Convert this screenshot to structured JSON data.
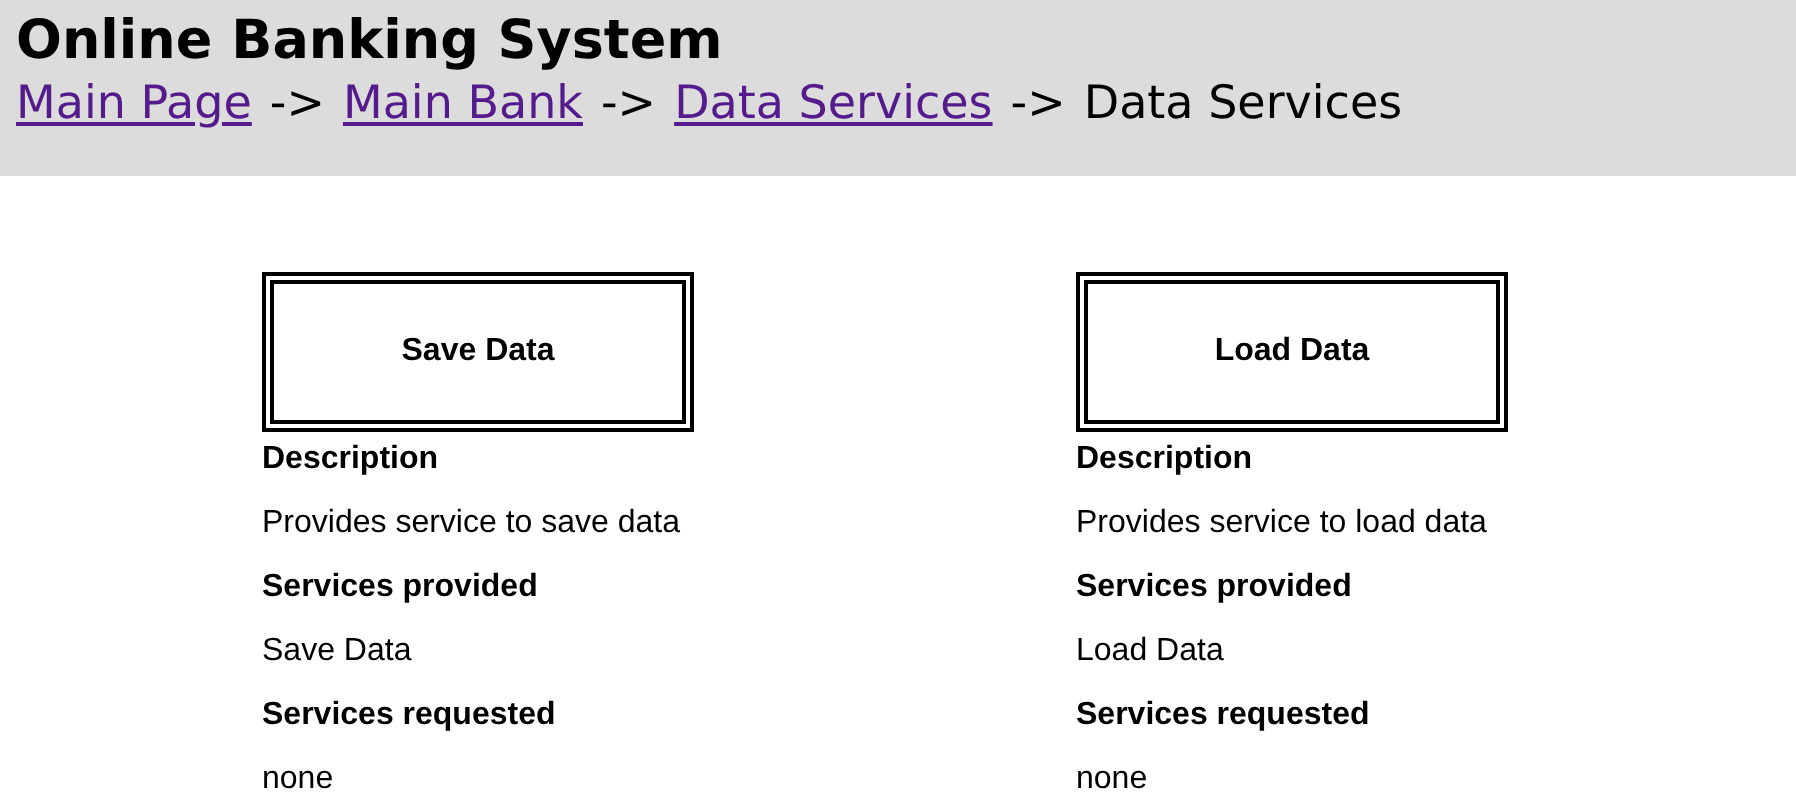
{
  "header": {
    "title": "Online Banking System",
    "breadcrumb": [
      {
        "kind": "link",
        "label": "Main Page"
      },
      {
        "kind": "separator",
        "label": "->"
      },
      {
        "kind": "link",
        "label": "Main Bank"
      },
      {
        "kind": "separator",
        "label": "->"
      },
      {
        "kind": "link",
        "label": "Data Services"
      },
      {
        "kind": "separator",
        "label": "->"
      },
      {
        "kind": "current",
        "label": "Data Services"
      }
    ]
  },
  "services": [
    {
      "title": "Save Data",
      "sections": [
        {
          "heading": "Description",
          "text": "Provides service to save data"
        },
        {
          "heading": "Services provided",
          "text": "Save Data"
        },
        {
          "heading": "Services requested",
          "text": "none"
        }
      ]
    },
    {
      "title": "Load Data",
      "sections": [
        {
          "heading": "Description",
          "text": "Provides service to load data"
        },
        {
          "heading": "Services provided",
          "text": "Load Data"
        },
        {
          "heading": "Services requested",
          "text": "none"
        }
      ]
    }
  ]
}
